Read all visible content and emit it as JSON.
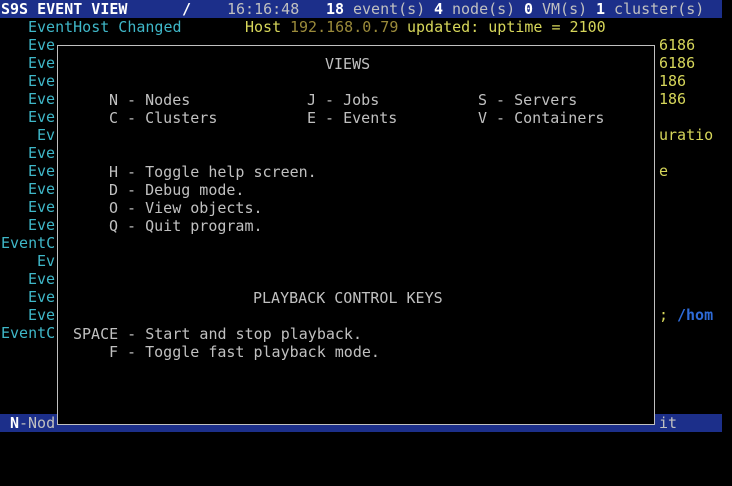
{
  "header": {
    "title": "S9S EVENT VIEW",
    "separator": "/",
    "time": "16:16:48",
    "event_count": "18",
    "event_label": "event(s)",
    "node_count": "4",
    "node_label": "node(s)",
    "vm_count": "0",
    "vm_label": "VM(s)",
    "cluster_count": "1",
    "cluster_label": "cluster(s)"
  },
  "events": {
    "first_event": "EventHost Changed",
    "first_message_prefix": "Host",
    "first_ip": "192.168.0.79",
    "first_message_suffix": "updated: uptime = 2100",
    "rows": [
      {
        "left": "Eve",
        "right": "6186"
      },
      {
        "left": "Eve",
        "right": "6186"
      },
      {
        "left": "Eve",
        "right": "186"
      },
      {
        "left": "Eve",
        "right": "186"
      },
      {
        "left": "Eve",
        "right": ""
      },
      {
        "left": "Ev",
        "right": "uratio"
      },
      {
        "left": "Eve",
        "right": ""
      },
      {
        "left": "Eve",
        "right": "e"
      },
      {
        "left": "Eve",
        "right": ""
      },
      {
        "left": "Eve",
        "right": ""
      },
      {
        "left": "Eve",
        "right": ""
      },
      {
        "left": "EventC",
        "right": ""
      },
      {
        "left": "Ev",
        "right": ""
      },
      {
        "left": "Eve",
        "right": ""
      },
      {
        "left": "Eve",
        "right": ""
      },
      {
        "left": "Eve",
        "right": "; "
      },
      {
        "left": "EventC",
        "right": ""
      }
    ],
    "path_fragment": "/hom"
  },
  "footer": {
    "key": "N",
    "label": "-Nod",
    "right": "it"
  },
  "help": {
    "views_title": "VIEWS",
    "views": [
      {
        "key_label": "N - Nodes"
      },
      {
        "key_label": "J - Jobs"
      },
      {
        "key_label": "S - Servers"
      },
      {
        "key_label": "C - Clusters"
      },
      {
        "key_label": "E - Events"
      },
      {
        "key_label": "V - Containers"
      }
    ],
    "commands": [
      "H - Toggle help screen.",
      "D - Debug mode.",
      "O - View objects.",
      "Q - Quit program."
    ],
    "playback_title": "PLAYBACK CONTROL KEYS",
    "playback": [
      "SPACE - Start and stop playback.",
      "F - Toggle fast playback mode."
    ]
  },
  "colors": {
    "bar_background": "#1c2f8a",
    "event_text": "#3fb7c8",
    "message_text": "#d6d65a",
    "ip_text": "#9a8a3a",
    "path_text": "#2e6bd8"
  }
}
